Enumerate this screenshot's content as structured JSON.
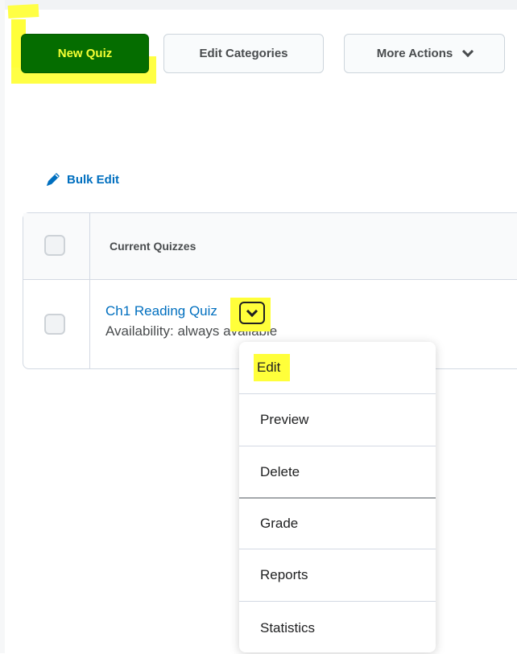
{
  "toolbar": {
    "new_quiz_label": "New Quiz",
    "edit_categories_label": "Edit Categories",
    "more_actions_label": "More Actions"
  },
  "bulk_edit_label": "Bulk Edit",
  "table": {
    "header_title": "Current Quizzes",
    "rows": [
      {
        "title": "Ch1 Reading Quiz",
        "availability": "Availability: always available"
      }
    ]
  },
  "context_menu": {
    "items": [
      "Edit",
      "Preview",
      "Delete",
      "Grade",
      "Reports",
      "Statistics"
    ]
  },
  "colors": {
    "primary": "#056d00",
    "link": "#006fbf",
    "highlight": "#ffff3a"
  },
  "icons": [
    "pencil-icon",
    "chevron-down-icon"
  ]
}
